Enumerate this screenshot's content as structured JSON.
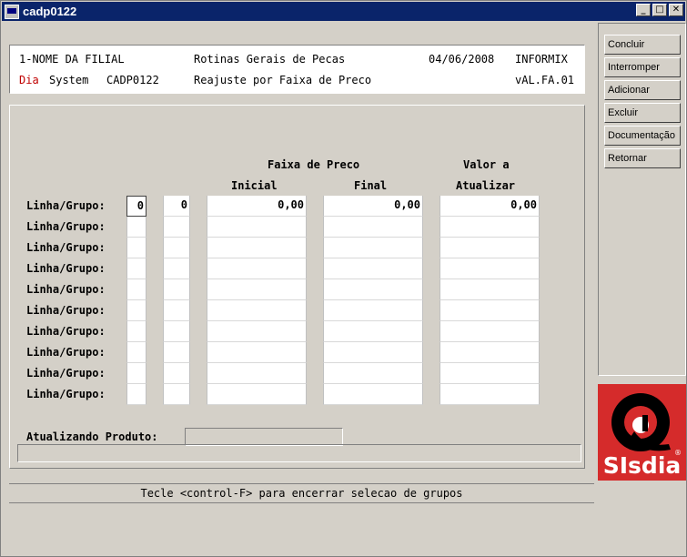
{
  "window": {
    "title": "cadp0122",
    "minimize": "_",
    "maximize": "□",
    "close": "✕"
  },
  "header": {
    "company": "1-NOME DA FILIAL",
    "module": "Rotinas Gerais de Pecas",
    "date": "04/06/2008",
    "dbms": "INFORMIX",
    "brand_prefix": "Dia",
    "brand_suffix": "System",
    "program": "CADP0122",
    "screen_title": "Reajuste por Faixa de Preco",
    "screen_code": "vAL.FA.01"
  },
  "form": {
    "col_faixa": "Faixa de Preco",
    "col_inicial": "Inicial",
    "col_final": "Final",
    "col_valor_top": "Valor a",
    "col_valor_bottom": "Atualizar",
    "row_label": "Linha/Grupo:",
    "rows": [
      {
        "linha": "0",
        "grupo": "0",
        "inicial": "0,00",
        "final": "0,00",
        "valor": "0,00"
      },
      {
        "linha": "",
        "grupo": "",
        "inicial": "",
        "final": "",
        "valor": ""
      },
      {
        "linha": "",
        "grupo": "",
        "inicial": "",
        "final": "",
        "valor": ""
      },
      {
        "linha": "",
        "grupo": "",
        "inicial": "",
        "final": "",
        "valor": ""
      },
      {
        "linha": "",
        "grupo": "",
        "inicial": "",
        "final": "",
        "valor": ""
      },
      {
        "linha": "",
        "grupo": "",
        "inicial": "",
        "final": "",
        "valor": ""
      },
      {
        "linha": "",
        "grupo": "",
        "inicial": "",
        "final": "",
        "valor": ""
      },
      {
        "linha": "",
        "grupo": "",
        "inicial": "",
        "final": "",
        "valor": ""
      },
      {
        "linha": "",
        "grupo": "",
        "inicial": "",
        "final": "",
        "valor": ""
      },
      {
        "linha": "",
        "grupo": "",
        "inicial": "",
        "final": "",
        "valor": ""
      }
    ],
    "atualizando_label": "Atualizando Produto:",
    "atualizando_value": ""
  },
  "footer": {
    "message": "Tecle <control-F> para encerrar selecao de grupos"
  },
  "sidebar": {
    "buttons": [
      "Concluir",
      "Interromper",
      "Adicionar",
      "Excluir",
      "Documentação",
      "Retornar"
    ]
  },
  "logo": {
    "text": "SIsdia",
    "registered": "®"
  },
  "colors": {
    "titlebar": "#0a246a",
    "accent_red": "#c00000",
    "logo_red": "#d52b2b"
  }
}
